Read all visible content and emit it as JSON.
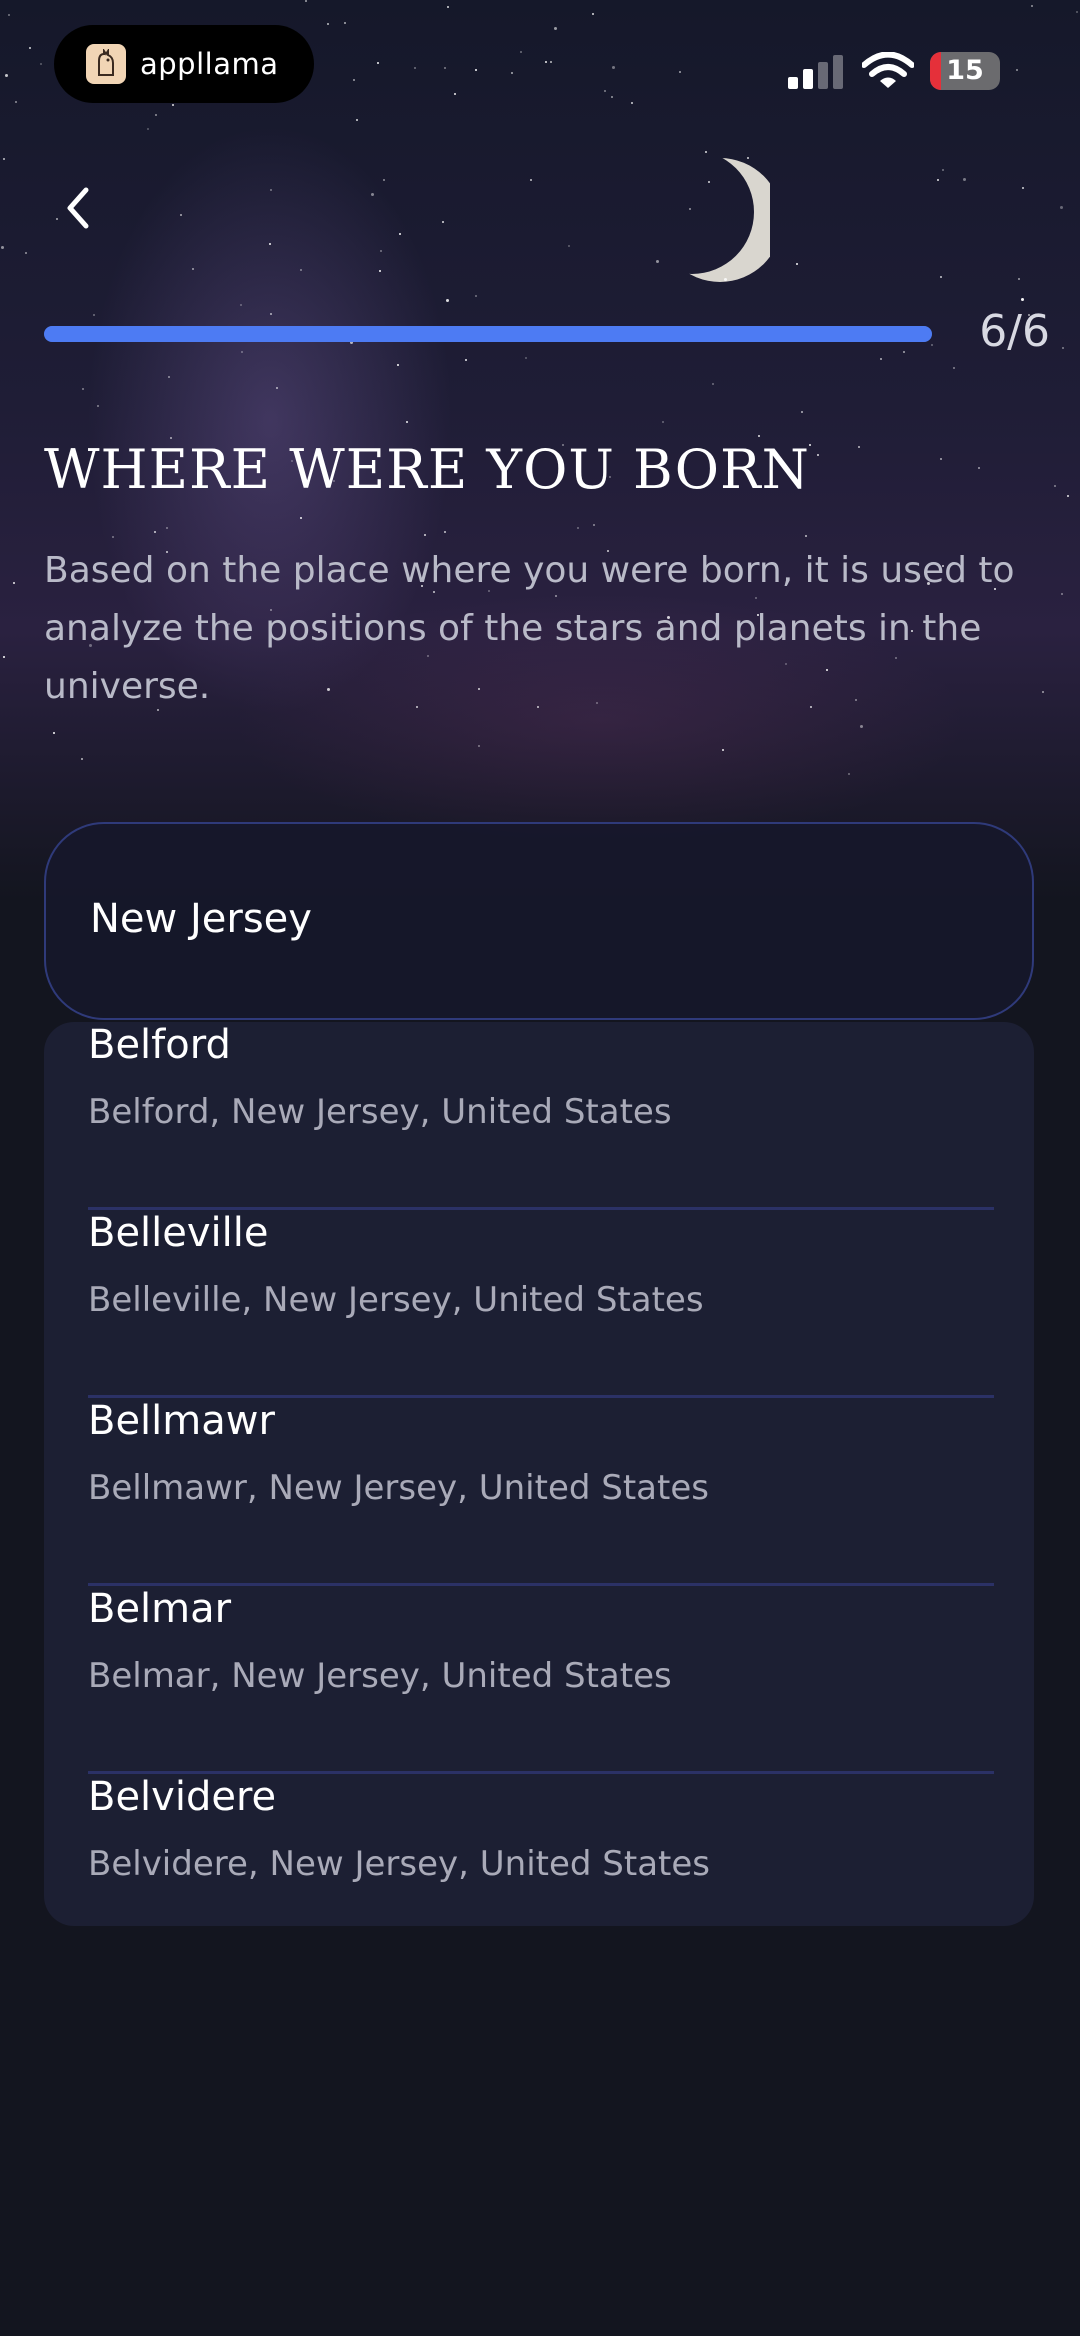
{
  "status_bar": {
    "app_name": "appllama",
    "app_logo_icon": "llama-logo-icon",
    "signal_icon": "cellular-signal-icon",
    "wifi_icon": "wifi-icon",
    "battery_level": "15",
    "battery_fraction": 0.15,
    "battery_color": "#e5303a"
  },
  "header": {
    "back_icon": "chevron-left-icon",
    "progress_fraction": 1.0,
    "progress_color": "#4d7bf3",
    "step_label": "6/6"
  },
  "content": {
    "title": "WHERE WERE YOU BORN",
    "description": "Based on the place where you were born, it is used to analyze the positions of the stars and planets in the universe."
  },
  "search": {
    "value": "New Jersey"
  },
  "results": [
    {
      "name": "Belford",
      "detail": "Belford,  New Jersey,  United States"
    },
    {
      "name": "Belleville",
      "detail": "Belleville,  New Jersey,  United States"
    },
    {
      "name": "Bellmawr",
      "detail": "Bellmawr,  New Jersey,  United States"
    },
    {
      "name": "Belmar",
      "detail": "Belmar,  New Jersey,  United States"
    },
    {
      "name": "Belvidere",
      "detail": "Belvidere,  New Jersey,  United States"
    }
  ]
}
